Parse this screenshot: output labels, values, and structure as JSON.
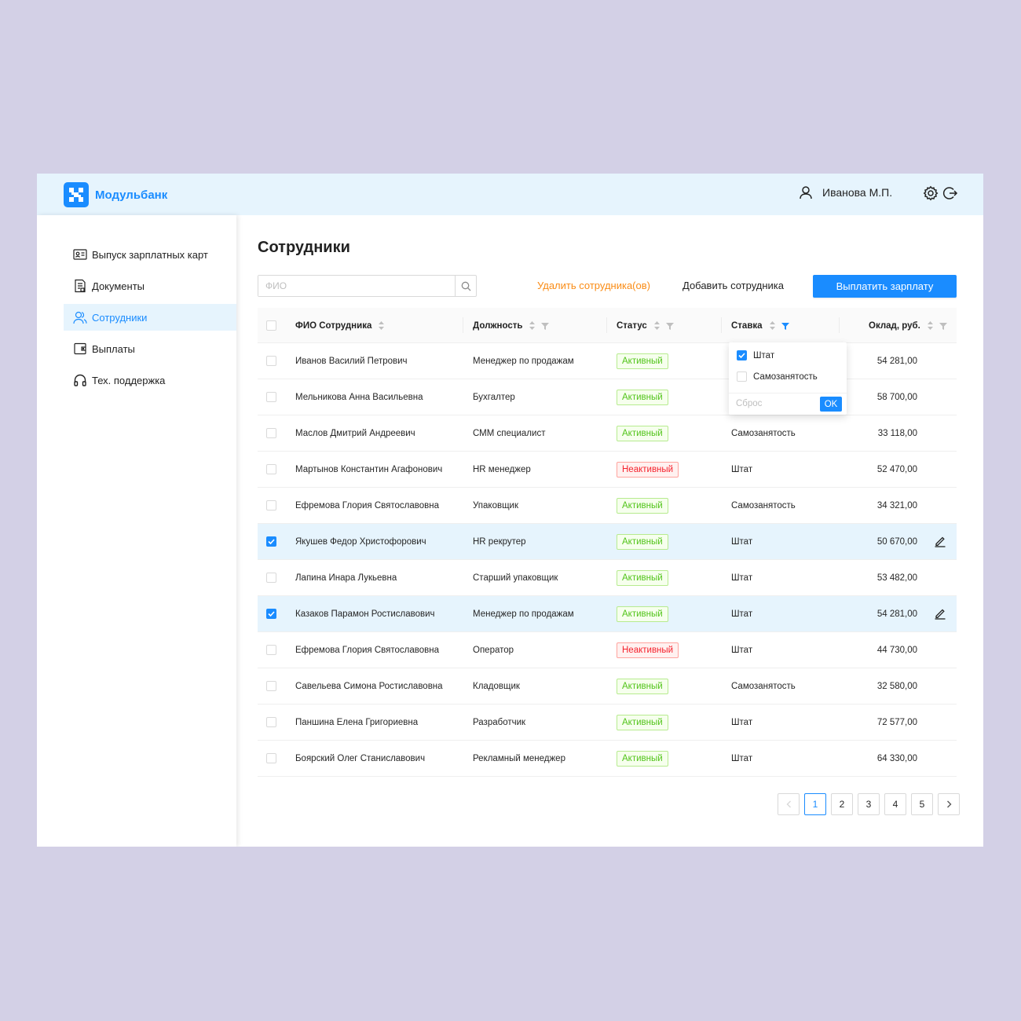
{
  "brand": {
    "name": "Модульбанк",
    "color": "#1a8cff"
  },
  "header": {
    "user_name": "Иванова М.П.",
    "user_icon": "user-icon",
    "settings_icon": "gear-icon",
    "logout_icon": "logout-icon"
  },
  "sidebar": {
    "items": [
      {
        "label": "Выпуск зарплатных карт",
        "icon": "id-card-icon",
        "active": false
      },
      {
        "label": "Документы",
        "icon": "document-icon",
        "active": false
      },
      {
        "label": "Сотрудники",
        "icon": "users-icon",
        "active": true
      },
      {
        "label": "Выплаты",
        "icon": "wallet-icon",
        "active": false
      },
      {
        "label": "Тех. поддержка",
        "icon": "headphones-icon",
        "active": false
      }
    ]
  },
  "main": {
    "title": "Сотрудники",
    "search": {
      "placeholder": "ФИО",
      "value": ""
    },
    "actions": {
      "delete": "Удалить сотрудника(ов)",
      "add": "Добавить сотрудника",
      "pay": "Выплатить зарплату"
    }
  },
  "table": {
    "columns": {
      "name": "ФИО Сотрудника",
      "position": "Должность",
      "status": "Статус",
      "rate": "Ставка",
      "salary": "Оклад, руб."
    },
    "rows": [
      {
        "selected": false,
        "name": "Иванов Василий Петрович",
        "position": "Менеджер по продажам",
        "status": "Активный",
        "status_type": "active",
        "rate": "",
        "salary": "54 281,00"
      },
      {
        "selected": false,
        "name": "Мельникова Анна Васильевна",
        "position": "Бухгалтер",
        "status": "Активный",
        "status_type": "active",
        "rate": "",
        "salary": "58 700,00"
      },
      {
        "selected": false,
        "name": "Маслов Дмитрий Андреевич",
        "position": "СММ специалист",
        "status": "Активный",
        "status_type": "active",
        "rate": "Самозанятость",
        "salary": "33 118,00"
      },
      {
        "selected": false,
        "name": "Мартынов Константин Агафонович",
        "position": "HR менеджер",
        "status": "Неактивный",
        "status_type": "inactive",
        "rate": "Штат",
        "salary": "52 470,00"
      },
      {
        "selected": false,
        "name": "Ефремова Глория Святославовна",
        "position": "Упаковщик",
        "status": "Активный",
        "status_type": "active",
        "rate": "Самозанятость",
        "salary": "34 321,00"
      },
      {
        "selected": true,
        "name": "Якушев Федор Христофорович",
        "position": "HR рекрутер",
        "status": "Активный",
        "status_type": "active",
        "rate": "Штат",
        "salary": "50 670,00"
      },
      {
        "selected": false,
        "name": "Лапина Инара Лукьевна",
        "position": "Старший упаковщик",
        "status": "Активный",
        "status_type": "active",
        "rate": "Штат",
        "salary": "53 482,00"
      },
      {
        "selected": true,
        "name": "Казаков Парамон Ростиславович",
        "position": "Менеджер по продажам",
        "status": "Активный",
        "status_type": "active",
        "rate": "Штат",
        "salary": "54 281,00"
      },
      {
        "selected": false,
        "name": "Ефремова Глория Святославовна",
        "position": "Оператор",
        "status": "Неактивный",
        "status_type": "inactive",
        "rate": "Штат",
        "salary": "44 730,00"
      },
      {
        "selected": false,
        "name": "Савельева Симона Ростиславовна",
        "position": "Кладовщик",
        "status": "Активный",
        "status_type": "active",
        "rate": "Самозанятость",
        "salary": "32 580,00"
      },
      {
        "selected": false,
        "name": "Паншина Елена Григориевна",
        "position": "Разработчик",
        "status": "Активный",
        "status_type": "active",
        "rate": "Штат",
        "salary": "72 577,00"
      },
      {
        "selected": false,
        "name": "Боярский Олег Станиславович",
        "position": "Рекламный менеджер",
        "status": "Активный",
        "status_type": "active",
        "rate": "Штат",
        "salary": "64 330,00"
      }
    ]
  },
  "rate_filter": {
    "options": [
      {
        "label": "Штат",
        "checked": true
      },
      {
        "label": "Самозанятость",
        "checked": false
      }
    ],
    "reset": "Сброс",
    "ok": "OK"
  },
  "pagination": {
    "prev_icon": "chevron-left-icon",
    "pages": [
      "1",
      "2",
      "3",
      "4",
      "5"
    ],
    "current": "1",
    "next_icon": "chevron-right-icon"
  }
}
